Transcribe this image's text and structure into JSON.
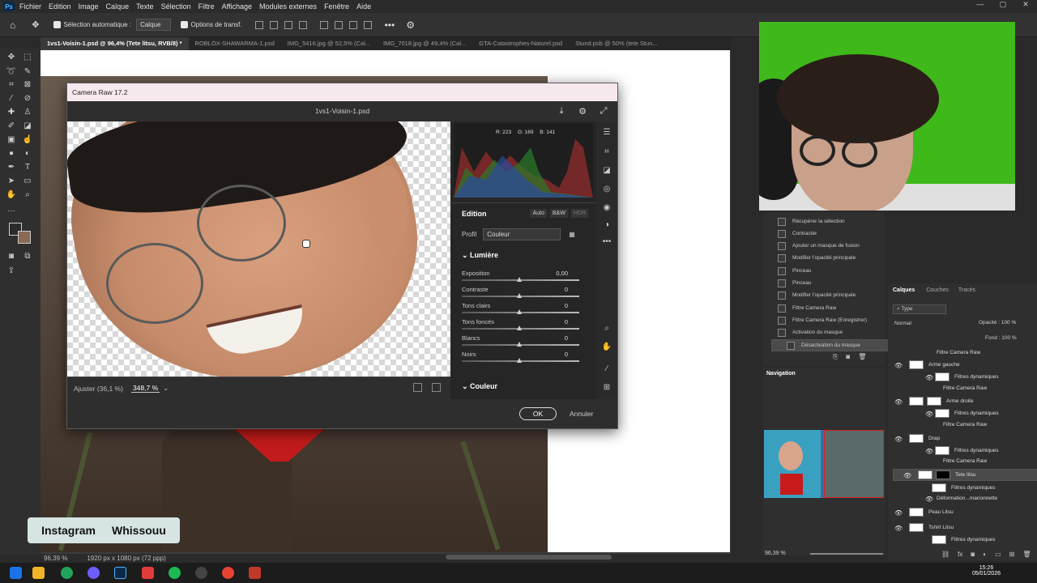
{
  "menubar": {
    "items": [
      "Fichier",
      "Edition",
      "Image",
      "Calque",
      "Texte",
      "Sélection",
      "Filtre",
      "Affichage",
      "Modules externes",
      "Fenêtre",
      "Aide"
    ]
  },
  "options": {
    "auto_select": "Sélection automatique :",
    "target": "Calque",
    "transform": "Options de transf."
  },
  "tabs": [
    "1vs1-Voisin-1.psd @ 96,4% (Tete litsu, RVB/8) *",
    "ROBLOX-SHAWARMA-1.psd",
    "IMG_5416.jpg @ 52,5% (Cal...",
    "IMG_7018.jpg @ 49,4% (Cal...",
    "GTA-Catastrophes-Naturel.psd",
    "Stund.psb @ 50% (tete Stun..."
  ],
  "camera_raw": {
    "title": "Camera Raw 17.2",
    "filename": "1vs1-Voisin-1.psd",
    "readout": {
      "r": "R: 223",
      "g": "G: 169",
      "b": "B: 141"
    },
    "edition": "Edition",
    "buttons": {
      "auto": "Auto",
      "bw": "B&W",
      "hdr": "HDR"
    },
    "profil_label": "Profil",
    "profil_value": "Couleur",
    "section_light": "Lumière",
    "sliders": [
      {
        "label": "Exposition",
        "value": "0,00"
      },
      {
        "label": "Contraste",
        "value": "0"
      },
      {
        "label": "Tons clairs",
        "value": "0"
      },
      {
        "label": "Tons foncés",
        "value": "0"
      },
      {
        "label": "Blancs",
        "value": "0"
      },
      {
        "label": "Noirs",
        "value": "0"
      }
    ],
    "section_color": "Couleur",
    "fit": "Ajuster (36,1 %)",
    "zoom": "348,7 %",
    "ok": "OK",
    "cancel": "Annuler"
  },
  "history": [
    "Récupérer la sélection",
    "Contracter",
    "Ajouter un masque de fusion",
    "Modifier l'opacité principale",
    "Pinceau",
    "Pinceau",
    "Modifier l'opacité principale",
    "Filtre Camera Raw",
    "Filtre Camera Raw (Enregistrer)",
    "Activation du masque",
    "Désactivation du masque"
  ],
  "navigator": {
    "title": "Navigation",
    "zoom": "96,39 %"
  },
  "layers_panel": {
    "tabs": [
      "Calques",
      "Couches",
      "Tracés"
    ],
    "kind": "Type",
    "blend": "Normal",
    "opacity_label": "Opacité :",
    "opacity": "100 %",
    "fill_label": "Fond :",
    "fill": "100 %",
    "rows": [
      "Filtre Camera Raw",
      "Arme gauche",
      "Filtres dynamiques",
      "Filtre Camera Raw",
      "Arme droite",
      "Filtres dynamiques",
      "Filtre Camera Raw",
      "Drap",
      "Filtres dynamiques",
      "Filtre Camera Raw",
      "Tete litsu",
      "Filtres dynamiques",
      "Déformation...marionnette",
      "Peau Litsu",
      "Tshirt Litsu",
      "Filtres dynamiques"
    ]
  },
  "status": {
    "zoom": "96,39 %",
    "size": "1920 px x 1080 px (72 ppp)"
  },
  "social": {
    "network": "Instagram",
    "handle": "Whissouu"
  },
  "clock": {
    "time": "15:26",
    "date": "05/01/2026"
  },
  "colors": {
    "ps_blue": "#4fb7ff",
    "green_screen": "#3fb81a",
    "cr_titlebar": "#f6e9ee"
  }
}
